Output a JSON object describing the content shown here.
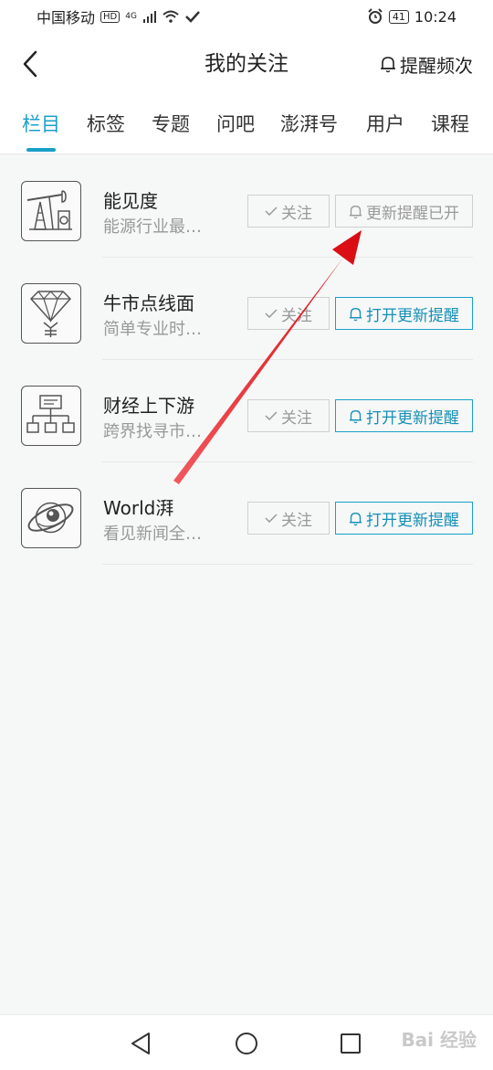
{
  "status_bar": {
    "carrier": "中国移动",
    "hd": "HD",
    "network": "4G",
    "battery": "41",
    "time": "10:24"
  },
  "header": {
    "title": "我的关注",
    "remind_label": "提醒频次"
  },
  "tabs": [
    {
      "label": "栏目",
      "active": true
    },
    {
      "label": "标签"
    },
    {
      "label": "专题"
    },
    {
      "label": "问吧"
    },
    {
      "label": "澎湃号"
    },
    {
      "label": "用户"
    },
    {
      "label": "课程"
    }
  ],
  "items": [
    {
      "name": "能见度",
      "desc": "能源行业最…",
      "follow_label": "关注",
      "remind_label": "更新提醒已开",
      "remind_on": true,
      "icon": "oil-pump-icon"
    },
    {
      "name": "牛市点线面",
      "desc": "简单专业时…",
      "follow_label": "关注",
      "remind_label": "打开更新提醒",
      "remind_on": false,
      "icon": "diamond-icon"
    },
    {
      "name": "财经上下游",
      "desc": "跨界找寻市…",
      "follow_label": "关注",
      "remind_label": "打开更新提醒",
      "remind_on": false,
      "icon": "org-chart-icon"
    },
    {
      "name": "World湃",
      "desc": "看见新闻全…",
      "follow_label": "关注",
      "remind_label": "打开更新提醒",
      "remind_on": false,
      "icon": "planet-icon"
    }
  ],
  "watermark": "Bai 经验",
  "colors": {
    "accent": "#1aa0c8",
    "annotation_arrow": "#e8141b"
  }
}
